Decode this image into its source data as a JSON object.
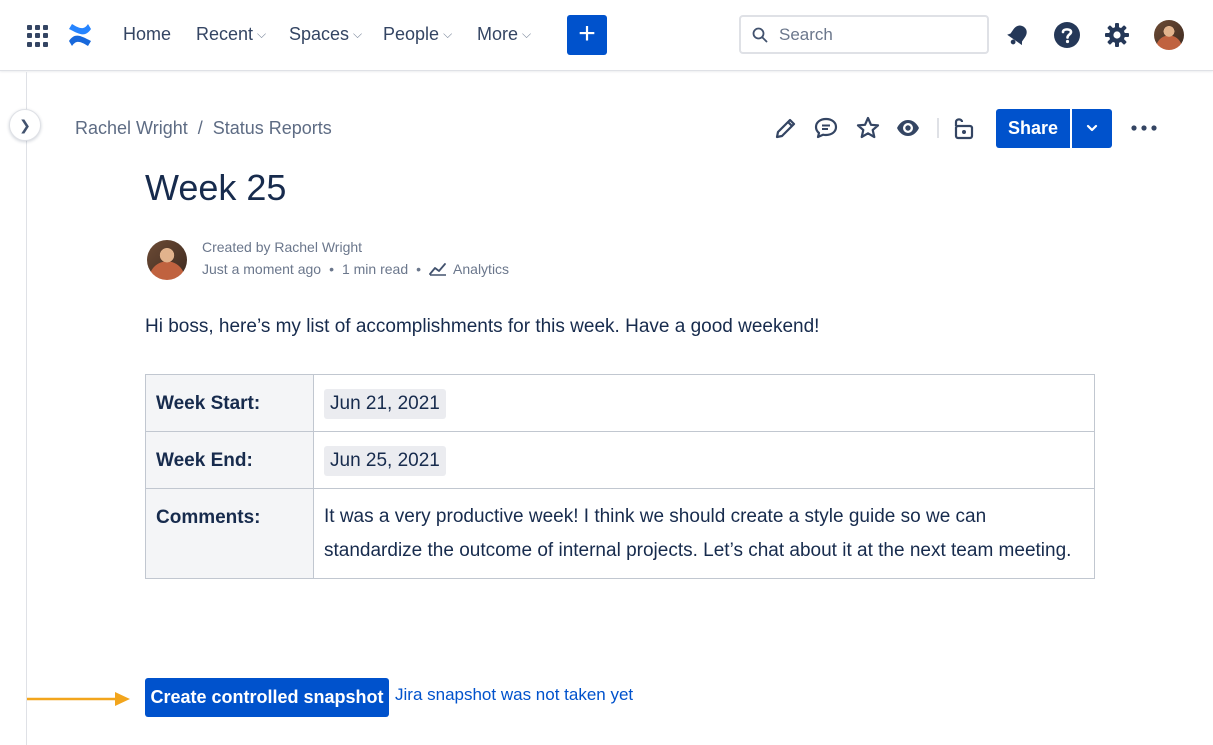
{
  "nav": {
    "items": [
      {
        "label": "Home",
        "dropdown": false
      },
      {
        "label": "Recent",
        "dropdown": true
      },
      {
        "label": "Spaces",
        "dropdown": true
      },
      {
        "label": "People",
        "dropdown": true
      },
      {
        "label": "More",
        "dropdown": true
      }
    ],
    "create_label": "+",
    "search_placeholder": "Search",
    "icons": [
      "app-switcher-icon",
      "confluence-logo-icon",
      "notifications-icon",
      "help-icon",
      "settings-icon",
      "profile-avatar"
    ]
  },
  "breadcrumb": {
    "items": [
      "Rachel Wright",
      "Status Reports"
    ],
    "separator": "/"
  },
  "toolbar": {
    "icons": [
      "edit-icon",
      "comment-icon",
      "star-icon",
      "watch-icon",
      "restrictions-unlock-icon"
    ],
    "share_label": "Share",
    "more_icon": "more-actions-icon"
  },
  "page": {
    "title": "Week 25",
    "byline": "Created by Rachel Wright",
    "time": "Just a moment ago",
    "read_time": "1 min read",
    "analytics": "Analytics",
    "meta_separator": "•",
    "intro": "Hi boss, here’s my list of accomplishments for this week. Have a good weekend!"
  },
  "table": {
    "rows": [
      {
        "label": "Week Start:",
        "value": "Jun 21, 2021",
        "type": "date"
      },
      {
        "label": "Week End:",
        "value": "Jun 25, 2021",
        "type": "date"
      },
      {
        "label": "Comments:",
        "value": "It was a very productive week! I think we should create a style guide so we can standardize the outcome of internal projects. Let’s chat about it at the next team meeting.",
        "type": "text"
      }
    ]
  },
  "snapshot": {
    "button_label": "Create controlled snapshot",
    "note": "Jira snapshot was not taken yet"
  },
  "colors": {
    "brand_blue": "#0052cc",
    "text_primary": "#172b4d",
    "text_subtle": "#6b778c",
    "annotation_arrow": "#f2a51c"
  }
}
